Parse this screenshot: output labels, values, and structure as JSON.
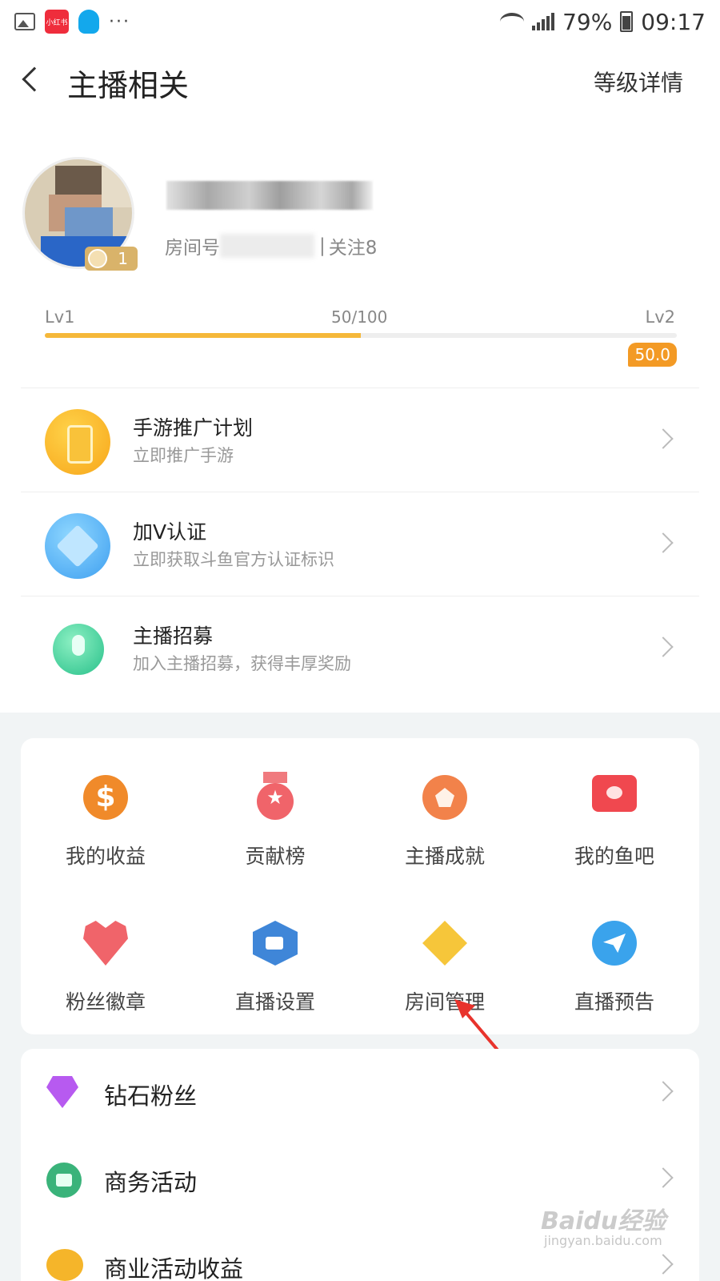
{
  "status_bar": {
    "xhs_label": "小红书",
    "more": "···",
    "battery": "79%",
    "time": "09:17"
  },
  "header": {
    "title": "主播相关",
    "right_link": "等级详情"
  },
  "profile": {
    "room_prefix": "房间号",
    "follow_label": "关注8",
    "avatar_level": "1"
  },
  "level": {
    "current": "Lv1",
    "next": "Lv2",
    "progress_text": "50/100",
    "progress": 0.5,
    "exp_badge": "50.0",
    "bar_color": "#f5b83a"
  },
  "menu": [
    {
      "title": "手游推广计划",
      "subtitle": "立即推广手游",
      "icon": "mobile-icon"
    },
    {
      "title": "加V认证",
      "subtitle": "立即获取斗鱼官方认证标识",
      "icon": "v-cert-icon"
    },
    {
      "title": "主播招募",
      "subtitle": "加入主播招募，获得丰厚奖励",
      "icon": "microphone-icon"
    }
  ],
  "grid": [
    {
      "label": "我的收益",
      "icon": "dollar-icon"
    },
    {
      "label": "贡献榜",
      "icon": "medal-icon"
    },
    {
      "label": "主播成就",
      "icon": "achievement-icon"
    },
    {
      "label": "我的鱼吧",
      "icon": "fish-bar-icon"
    },
    {
      "label": "粉丝徽章",
      "icon": "heart-badge-icon"
    },
    {
      "label": "直播设置",
      "icon": "camera-icon"
    },
    {
      "label": "房间管理",
      "icon": "layers-icon"
    },
    {
      "label": "直播预告",
      "icon": "paper-plane-icon"
    }
  ],
  "list": [
    {
      "label": "钻石粉丝",
      "icon": "diamond-icon"
    },
    {
      "label": "商务活动",
      "icon": "briefcase-icon"
    },
    {
      "label": "商业活动收益",
      "icon": "piggy-bank-icon"
    }
  ],
  "watermark": {
    "main": "Baidu经验",
    "sub": "jingyan.baidu.com"
  },
  "colors": {
    "accent": "#f5b83a",
    "badge": "#f39a25",
    "annotation_arrow": "#e8332c"
  }
}
